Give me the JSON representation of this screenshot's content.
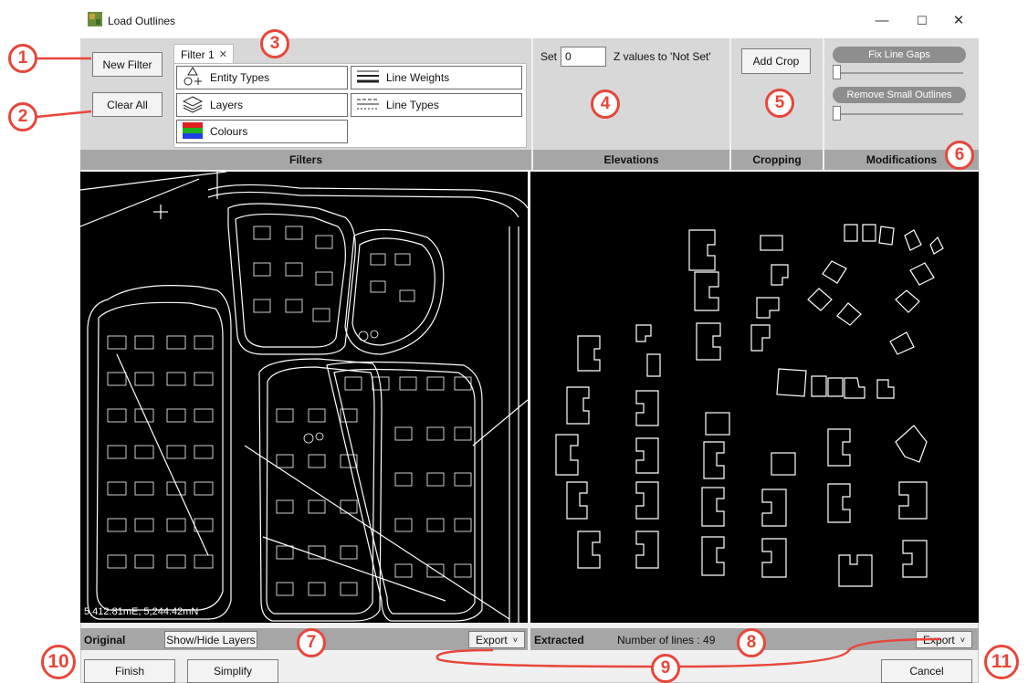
{
  "window": {
    "title": "Load Outlines",
    "min": "—",
    "max": "☐",
    "close": "✕"
  },
  "filters": {
    "new_filter": "New Filter",
    "clear_all": "Clear All",
    "tab_label": "Filter 1",
    "tab_close": "✕",
    "chips": [
      "Entity Types",
      "Line Weights",
      "Layers",
      "Line Types",
      "Colours"
    ],
    "footer": "Filters"
  },
  "elevations": {
    "set": "Set",
    "value": "0",
    "suffix": "Z values to 'Not Set'",
    "footer": "Elevations"
  },
  "cropping": {
    "add_crop": "Add Crop",
    "footer": "Cropping"
  },
  "modifications": {
    "fix_gaps": "Fix Line Gaps",
    "remove_small": "Remove Small Outlines",
    "fix_gaps_level": 0,
    "remove_small_level": 0,
    "footer": "Modifications"
  },
  "original": {
    "label": "Original",
    "show_hide": "Show/Hide Layers",
    "export": "Export",
    "coords": "5,412.81mE, 5,244.42mN"
  },
  "extracted": {
    "label": "Extracted",
    "count": "Number of lines : 49",
    "export": "Export"
  },
  "footer": {
    "finish": "Finish",
    "simplify": "Simplify",
    "cancel": "Cancel"
  },
  "callouts": [
    "1",
    "2",
    "3",
    "4",
    "5",
    "6",
    "7",
    "8",
    "9",
    "10",
    "11"
  ],
  "colors": {
    "callout": "#e8463a",
    "panel": "#d8d8d8",
    "footer_bar": "#a6a6a6"
  }
}
